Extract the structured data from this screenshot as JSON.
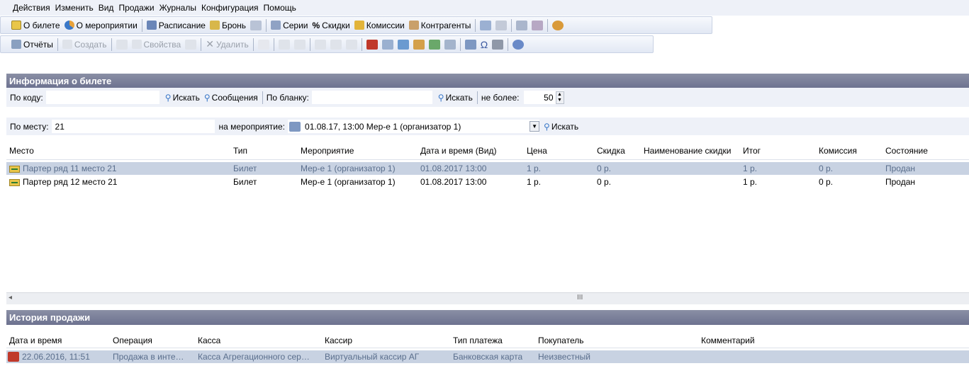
{
  "menu": [
    "Действия",
    "Изменить",
    "Вид",
    "Продажи",
    "Журналы",
    "Конфигурация",
    "Помощь"
  ],
  "toolbar1": {
    "ticket_info": "О билете",
    "event_info": "О мероприятии",
    "schedule": "Расписание",
    "booking": "Бронь",
    "series": "Серии",
    "discounts": "Скидки",
    "commissions": "Комиссии",
    "counterparties": "Контрагенты"
  },
  "toolbar2": {
    "reports": "Отчёты",
    "create": "Создать",
    "properties": "Свойства",
    "delete": "Удалить"
  },
  "ticket_panel": {
    "title": "Информация о билете",
    "by_code_label": "По коду:",
    "by_code_value": "",
    "search1": "Искать",
    "messages": "Сообщения",
    "by_blank_label": "По бланку:",
    "by_blank_value": "",
    "search2": "Искать",
    "limit_label": "не более:",
    "limit_value": "50",
    "by_seat_label": "По месту:",
    "by_seat_value": "21",
    "event_label": "на мероприятие:",
    "event_value": "01.08.17, 13:00 Мер-е 1 (организатор 1)",
    "search3": "Искать"
  },
  "tickets_table": {
    "columns": [
      "Место",
      "Тип",
      "Мероприятие",
      "Дата и время (Вид)",
      "Цена",
      "Скидка",
      "Наименование скидки",
      "Итог",
      "Комиссия",
      "Состояние"
    ],
    "rows": [
      [
        "Партер ряд 11 место 21",
        "Билет",
        "Мер-е 1 (организатор 1)",
        "01.08.2017 13:00",
        "1 р.",
        "0 р.",
        "",
        "1 р.",
        "0 р.",
        "Продан"
      ],
      [
        "Партер ряд 12 место 21",
        "Билет",
        "Мер-е 1 (организатор 1)",
        "01.08.2017 13:00",
        "1 р.",
        "0 р.",
        "",
        "1 р.",
        "0 р.",
        "Продан"
      ]
    ],
    "scroll_mark": "III"
  },
  "history_panel": {
    "title": "История продажи",
    "columns": [
      "Дата и время",
      "Операция",
      "Касса",
      "Кассир",
      "Тип платежа",
      "Покупатель",
      "Комментарий"
    ],
    "rows": [
      [
        "22.06.2016, 11:51",
        "Продажа в инте…",
        "Касса Агрегационного сер…",
        "Виртуальный кассир АГ",
        "Банковская карта",
        "Неизвестный",
        ""
      ]
    ]
  },
  "colors": {
    "panel_header": "#7a7f9a",
    "selection": "#c8d2e2",
    "filter_bg": "#eef1f8"
  }
}
